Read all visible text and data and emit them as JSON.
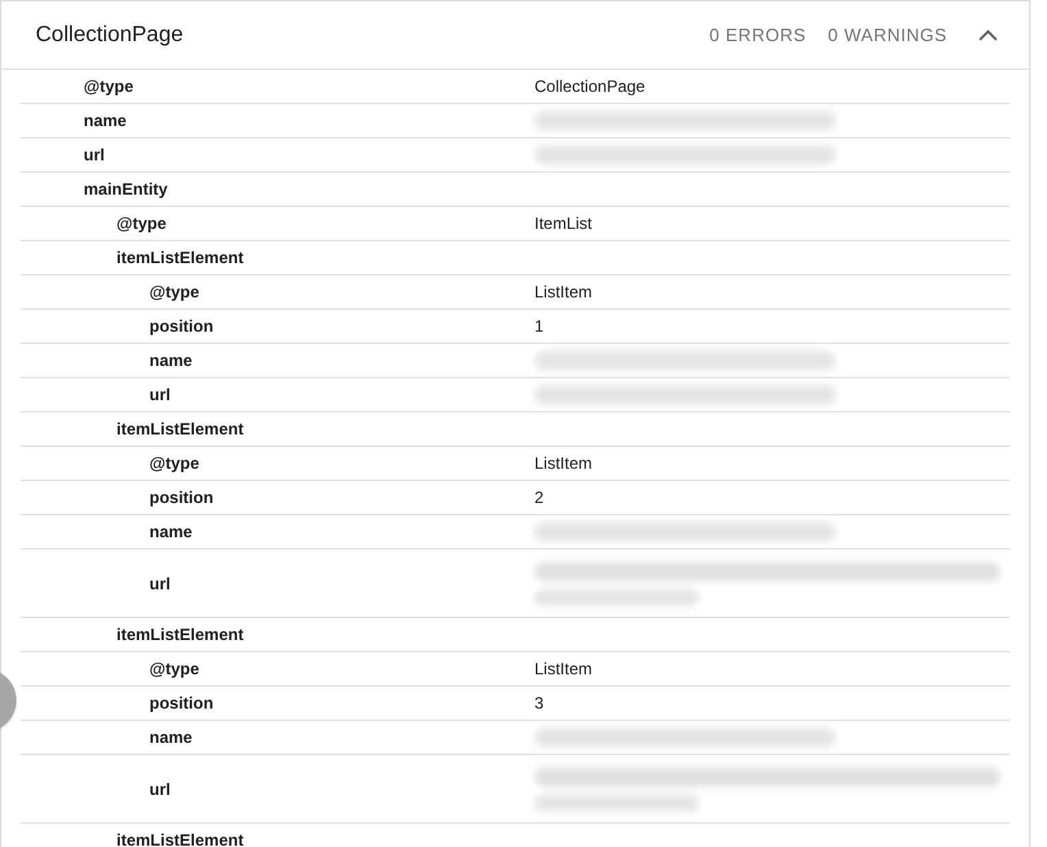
{
  "header": {
    "title": "CollectionPage",
    "errors": "0 ERRORS",
    "warnings": "0 WARNINGS",
    "expanded": true
  },
  "rows": [
    {
      "key": "@type",
      "kind": "text",
      "value": "CollectionPage"
    },
    {
      "key": "name",
      "kind": "blurred"
    },
    {
      "key": "url",
      "kind": "blurred"
    },
    {
      "key": "mainEntity",
      "kind": "group",
      "children": [
        {
          "key": "@type",
          "kind": "text",
          "value": "ItemList"
        },
        {
          "key": "itemListElement",
          "kind": "group",
          "children": [
            {
              "key": "@type",
              "kind": "text",
              "value": "ListItem"
            },
            {
              "key": "position",
              "kind": "text",
              "value": "1"
            },
            {
              "key": "name",
              "kind": "blurred"
            },
            {
              "key": "url",
              "kind": "blurred"
            }
          ]
        },
        {
          "key": "itemListElement",
          "kind": "group",
          "children": [
            {
              "key": "@type",
              "kind": "text",
              "value": "ListItem"
            },
            {
              "key": "position",
              "kind": "text",
              "value": "2"
            },
            {
              "key": "name",
              "kind": "blurred"
            },
            {
              "key": "url",
              "kind": "blurredtall"
            }
          ]
        },
        {
          "key": "itemListElement",
          "kind": "group",
          "children": [
            {
              "key": "@type",
              "kind": "text",
              "value": "ListItem"
            },
            {
              "key": "position",
              "kind": "text",
              "value": "3"
            },
            {
              "key": "name",
              "kind": "blurred"
            },
            {
              "key": "url",
              "kind": "blurredtall"
            }
          ]
        },
        {
          "key": "itemListElement",
          "kind": "group"
        }
      ]
    }
  ]
}
